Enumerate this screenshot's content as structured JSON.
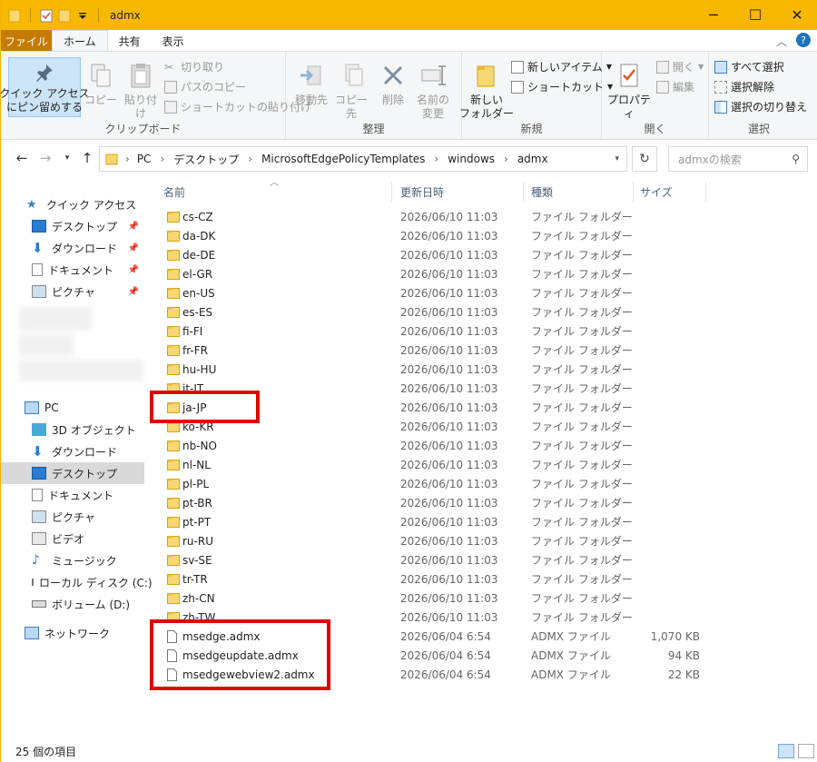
{
  "window": {
    "title": "admx",
    "minimize_icon": "minimize-icon",
    "maximize_icon": "maximize-icon",
    "close_icon": "close-icon",
    "accent": "#f9b800"
  },
  "tabs": {
    "file": "ファイル",
    "home": "ホーム",
    "share": "共有",
    "view": "表示"
  },
  "ribbon": {
    "clipboard": {
      "pin": "クイック アクセス\nにピン留めする",
      "copy": "コピー",
      "paste": "貼り付け",
      "cut": "切り取り",
      "copy_path": "パスのコピー",
      "paste_shortcut": "ショートカットの貼り付け",
      "label": "クリップボード"
    },
    "organize": {
      "move_to": "移動先",
      "copy_to": "コピー先",
      "delete": "削除",
      "rename": "名前の\n変更",
      "label": "整理"
    },
    "new": {
      "new_folder": "新しい\nフォルダー",
      "new_item": "新しいアイテム",
      "shortcut": "ショートカット",
      "label": "新規"
    },
    "open": {
      "properties": "プロパティ",
      "open": "開く",
      "edit": "編集",
      "label": "開く"
    },
    "select": {
      "select_all": "すべて選択",
      "select_none": "選択解除",
      "invert": "選択の切り替え",
      "label": "選択"
    }
  },
  "address": {
    "crumbs": [
      "PC",
      "デスクトップ",
      "MicrosoftEdgePolicyTemplates",
      "windows",
      "admx"
    ],
    "search_placeholder": "admxの検索"
  },
  "navpane": {
    "quick_access": "クイック アクセス",
    "qa_items": [
      "デスクトップ",
      "ダウンロード",
      "ドキュメント",
      "ピクチャ"
    ],
    "pc": "PC",
    "pc_items": [
      "3D オブジェクト",
      "ダウンロード",
      "デスクトップ",
      "ドキュメント",
      "ピクチャ",
      "ビデオ",
      "ミュージック",
      "ローカル ディスク (C:)",
      "ボリューム (D:)"
    ],
    "network": "ネットワーク"
  },
  "columns": {
    "name": "名前",
    "date": "更新日時",
    "type": "種類",
    "size": "サイズ"
  },
  "files": [
    {
      "name": "cs-CZ",
      "date": "2026/06/10 11:03",
      "type": "ファイル フォルダー",
      "size": "",
      "kind": "folder"
    },
    {
      "name": "da-DK",
      "date": "2026/06/10 11:03",
      "type": "ファイル フォルダー",
      "size": "",
      "kind": "folder"
    },
    {
      "name": "de-DE",
      "date": "2026/06/10 11:03",
      "type": "ファイル フォルダー",
      "size": "",
      "kind": "folder"
    },
    {
      "name": "el-GR",
      "date": "2026/06/10 11:03",
      "type": "ファイル フォルダー",
      "size": "",
      "kind": "folder"
    },
    {
      "name": "en-US",
      "date": "2026/06/10 11:03",
      "type": "ファイル フォルダー",
      "size": "",
      "kind": "folder"
    },
    {
      "name": "es-ES",
      "date": "2026/06/10 11:03",
      "type": "ファイル フォルダー",
      "size": "",
      "kind": "folder"
    },
    {
      "name": "fi-FI",
      "date": "2026/06/10 11:03",
      "type": "ファイル フォルダー",
      "size": "",
      "kind": "folder"
    },
    {
      "name": "fr-FR",
      "date": "2026/06/10 11:03",
      "type": "ファイル フォルダー",
      "size": "",
      "kind": "folder"
    },
    {
      "name": "hu-HU",
      "date": "2026/06/10 11:03",
      "type": "ファイル フォルダー",
      "size": "",
      "kind": "folder"
    },
    {
      "name": "it-IT",
      "date": "2026/06/10 11:03",
      "type": "ファイル フォルダー",
      "size": "",
      "kind": "folder"
    },
    {
      "name": "ja-JP",
      "date": "2026/06/10 11:03",
      "type": "ファイル フォルダー",
      "size": "",
      "kind": "folder"
    },
    {
      "name": "ko-KR",
      "date": "2026/06/10 11:03",
      "type": "ファイル フォルダー",
      "size": "",
      "kind": "folder"
    },
    {
      "name": "nb-NO",
      "date": "2026/06/10 11:03",
      "type": "ファイル フォルダー",
      "size": "",
      "kind": "folder"
    },
    {
      "name": "nl-NL",
      "date": "2026/06/10 11:03",
      "type": "ファイル フォルダー",
      "size": "",
      "kind": "folder"
    },
    {
      "name": "pl-PL",
      "date": "2026/06/10 11:03",
      "type": "ファイル フォルダー",
      "size": "",
      "kind": "folder"
    },
    {
      "name": "pt-BR",
      "date": "2026/06/10 11:03",
      "type": "ファイル フォルダー",
      "size": "",
      "kind": "folder"
    },
    {
      "name": "pt-PT",
      "date": "2026/06/10 11:03",
      "type": "ファイル フォルダー",
      "size": "",
      "kind": "folder"
    },
    {
      "name": "ru-RU",
      "date": "2026/06/10 11:03",
      "type": "ファイル フォルダー",
      "size": "",
      "kind": "folder"
    },
    {
      "name": "sv-SE",
      "date": "2026/06/10 11:03",
      "type": "ファイル フォルダー",
      "size": "",
      "kind": "folder"
    },
    {
      "name": "tr-TR",
      "date": "2026/06/10 11:03",
      "type": "ファイル フォルダー",
      "size": "",
      "kind": "folder"
    },
    {
      "name": "zh-CN",
      "date": "2026/06/10 11:03",
      "type": "ファイル フォルダー",
      "size": "",
      "kind": "folder"
    },
    {
      "name": "zh-TW",
      "date": "2026/06/10 11:03",
      "type": "ファイル フォルダー",
      "size": "",
      "kind": "folder"
    },
    {
      "name": "msedge.admx",
      "date": "2026/06/04 6:54",
      "type": "ADMX ファイル",
      "size": "1,070 KB",
      "kind": "file"
    },
    {
      "name": "msedgeupdate.admx",
      "date": "2026/06/04 6:54",
      "type": "ADMX ファイル",
      "size": "94 KB",
      "kind": "file"
    },
    {
      "name": "msedgewebview2.admx",
      "date": "2026/06/04 6:54",
      "type": "ADMX ファイル",
      "size": "22 KB",
      "kind": "file"
    }
  ],
  "highlight_color": "#e00000",
  "status": {
    "count": "25 個の項目"
  }
}
